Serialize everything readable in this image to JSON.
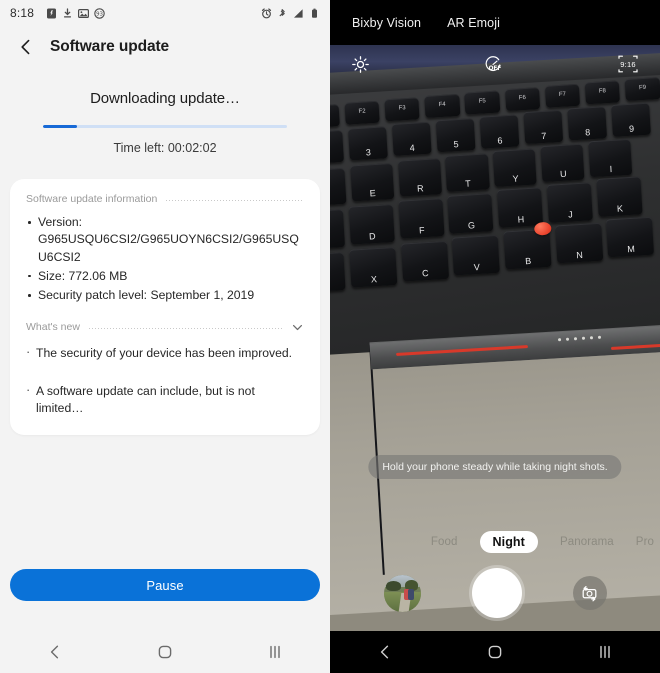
{
  "left_phone": {
    "status_bar": {
      "time": "8:18",
      "left_icons": [
        "notification-icon",
        "download-icon",
        "image-icon",
        "app-badge-icon"
      ],
      "right_icons": [
        "alarm-icon",
        "bluetooth-icon",
        "signal-icon",
        "battery-icon"
      ]
    },
    "app_bar": {
      "back_icon": "back-chevron-icon",
      "title": "Software update"
    },
    "download": {
      "title": "Downloading update…",
      "progress_percent": 14,
      "progress_fill_color": "#1769d6",
      "progress_track_color": "#cfdff5",
      "time_left_label": "Time left: 00:02:02"
    },
    "info_card": {
      "section_label": "Software update information",
      "bullets": [
        "Version: G965USQU6CSI2/G965UOYN6CSI2/G965USQU6CSI2",
        "Size: 772.06 MB",
        "Security patch level: September 1, 2019"
      ],
      "whats_new_label": "What's new",
      "whats_new_chevron": "chevron-down-icon",
      "whats_new_items": [
        "The security of your device has been improved.",
        "A software update can include, but is not limited…"
      ]
    },
    "pause_button": {
      "label": "Pause",
      "color": "#0a72d8"
    },
    "nav_bar": {
      "back": "back-icon",
      "home": "home-icon",
      "recents": "recents-icon"
    }
  },
  "right_phone": {
    "tabs": [
      {
        "label": "Bixby Vision"
      },
      {
        "label": "AR Emoji"
      }
    ],
    "toolbar": {
      "settings_icon": "gear-icon",
      "timer_icon": "timer-icon",
      "timer_value": "OFF",
      "aspect_icon": "aspect-ratio-icon",
      "aspect_value": "9:16"
    },
    "hint": "Hold your phone steady while taking night shots.",
    "modes": [
      {
        "label": "Food",
        "selected": false
      },
      {
        "label": "Night",
        "selected": true
      },
      {
        "label": "Panorama",
        "selected": false
      },
      {
        "label": "Pro",
        "selected": false
      }
    ],
    "controls": {
      "gallery_thumb": "gallery-thumbnail",
      "shutter": "shutter-button",
      "switch_camera_icon": "switch-camera-icon"
    },
    "nav_bar": {
      "back": "back-icon",
      "home": "home-icon",
      "recents": "recents-icon"
    },
    "viewfinder_scene": "laptop-keyboard-with-trackpoint"
  }
}
